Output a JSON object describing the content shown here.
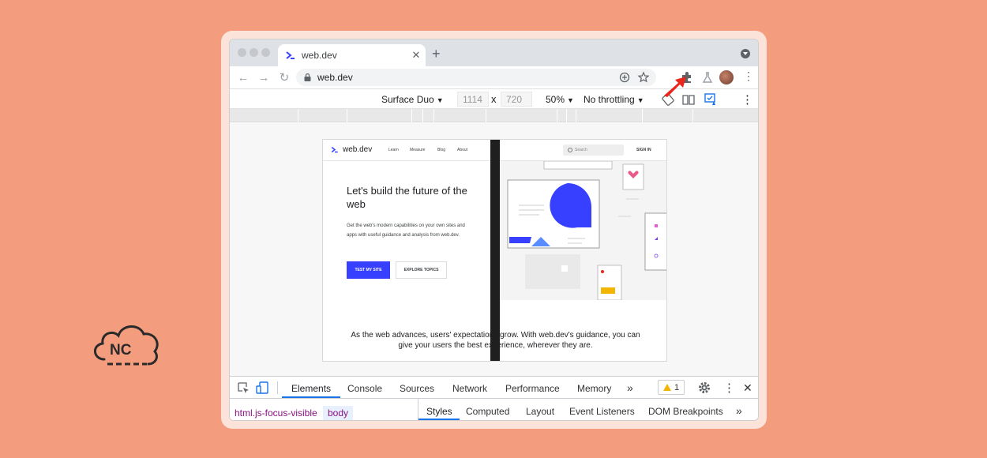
{
  "tab": {
    "title": "web.dev",
    "close": "✕",
    "new": "+"
  },
  "toolbar": {
    "url": "web.dev",
    "back": "←",
    "forward": "→",
    "reload": "↻",
    "menu": "⋮"
  },
  "device_toolbar": {
    "device": "Surface Duo",
    "width": "1114",
    "times": "x",
    "height": "720",
    "zoom": "50%",
    "throttle": "No throttling",
    "menu": "⋮",
    "arrow_color": "#e8261c"
  },
  "site": {
    "logo": "web.dev",
    "nav": [
      "Learn",
      "Measure",
      "Blog",
      "About"
    ],
    "search_placeholder": "Search",
    "signin": "SIGN IN",
    "hero_title": "Let's build the future of the web",
    "hero_body": "Get the web's modern capabilities on your own sites and apps with useful guidance and analysis from web.dev.",
    "primary_button": "TEST MY SITE",
    "secondary_button": "EXPLORE TOPICS",
    "lower_text": "As the web advances, users' expectations grow. With web.dev's guidance, you can give your users the best experience, wherever they are.",
    "accent": "#3740ff"
  },
  "devtools": {
    "tabs": [
      "Elements",
      "Console",
      "Sources",
      "Network",
      "Performance",
      "Memory"
    ],
    "more": "»",
    "warning_count": "1",
    "menu": "⋮",
    "close": "✕",
    "breadcrumbs": [
      "html.js-focus-visible",
      "body"
    ],
    "subtabs": [
      "Styles",
      "Computed",
      "Layout",
      "Event Listeners",
      "DOM Breakpoints"
    ],
    "sub_more": "»"
  },
  "logo": {
    "text": "NC"
  }
}
